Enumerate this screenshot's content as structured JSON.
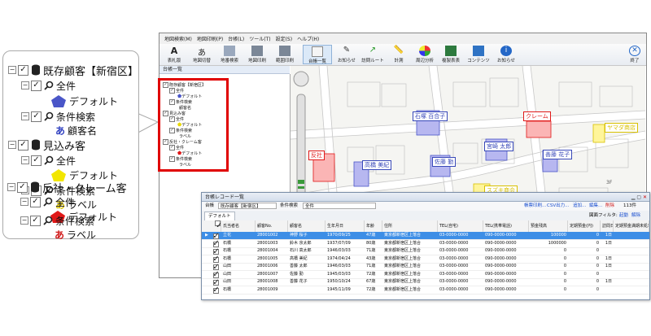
{
  "callout_tree": {
    "root": {
      "label": "既存顧客【新宿区】"
    },
    "items": [
      {
        "label": "全件"
      },
      {
        "label": "デフォルト"
      },
      {
        "label": "条件検索"
      },
      {
        "label": "顧客名"
      },
      {
        "label": "見込み客"
      },
      {
        "label": "全件"
      },
      {
        "label": "デフォルト"
      },
      {
        "label": "条件検索"
      },
      {
        "label": "ラベル"
      },
      {
        "label": "反社・クレーム客"
      },
      {
        "label": "全件"
      },
      {
        "label": "デフォルト"
      },
      {
        "label": "条件検索"
      },
      {
        "label": "ラベル"
      }
    ],
    "label_glyph": "あ",
    "colors": {
      "default_pentagon_1": "#4a56c8",
      "default_pentagon_2": "#f2e600",
      "default_pentagon_3": "#e01818",
      "label_icon_1": "#3040c0",
      "label_icon_2": "#d8c000",
      "label_icon_3": "#d01818"
    }
  },
  "app": {
    "menu": [
      "地図検索(M)",
      "地図印刷(P)",
      "台帳(L)",
      "ツール(T)",
      "設定(S)",
      "ヘルプ(H)"
    ],
    "toolbar": [
      "表札版",
      "地図切替",
      "地番検索",
      "地図印刷",
      "範囲印刷",
      "台帳一覧",
      "お知らせ",
      "訪問ルート",
      "計測",
      "周辺分析",
      "複製表表",
      "コンテンツ",
      "お知らせ"
    ],
    "close_label": "終了",
    "panel_title": "台帳一覧",
    "mini_tree": [
      "既存顧客【新宿区】",
      "全件",
      "デフォルト",
      "条件検索",
      "顧客名",
      "見込み客",
      "全件",
      "デフォルト",
      "条件検索",
      "ラベル",
      "反社・クレーム客",
      "全件",
      "デフォルト",
      "条件検索",
      "ラベル"
    ]
  },
  "map": {
    "labels": [
      {
        "text": "石塚 百合子",
        "color": "#3848b8"
      },
      {
        "text": "クレーム",
        "color": "#e01818"
      },
      {
        "text": "宮崎 太郎",
        "color": "#3848b8"
      },
      {
        "text": "反社",
        "color": "#e01818"
      },
      {
        "text": "高橋 美紀",
        "color": "#3848b8"
      },
      {
        "text": "佐藤 勤",
        "color": "#3848b8"
      },
      {
        "text": "善藤 花子",
        "color": "#3848b8"
      },
      {
        "text": "ヤマダ商店",
        "color": "#d8c000"
      },
      {
        "text": "スズキ商会",
        "color": "#d8c000"
      }
    ],
    "addr_labels": [
      "3F",
      "3F"
    ]
  },
  "record_list": {
    "title": "台帳レコード一覧",
    "ledger_label": "台帳",
    "ledger_value": "既存顧客【新宿区】",
    "cond_label": "条件検索",
    "cond_value": "全件",
    "actions": [
      "帳票印刷...",
      "CSV出力...",
      "追加...",
      "編集...",
      "削除"
    ],
    "count": "113件",
    "filter_label": "図面フィルタ:",
    "filter_values": [
      "起動",
      "解除"
    ],
    "tab": "デフォルト",
    "columns": [
      "氏当者名",
      "顧客No.",
      "顧客名",
      "生年月日",
      "年齢",
      "住所",
      "TEL(自宅)",
      "TEL(携帯電話)",
      "預金残高",
      "定期預金(円)",
      "訪問日",
      "定期預金満期未処理"
    ],
    "rows": [
      {
        "staff": "立花",
        "no": "28001002",
        "name": "神野 桜子",
        "birth": "1970/09/25",
        "age": "47歳",
        "addr": "東京都新宿区上落合",
        "tel": "03-0000-0000",
        "mobile": "090-0000-0000",
        "deposit": "100000",
        "fixed": "0",
        "visit": "1日",
        "selected": true
      },
      {
        "staff": "石橋",
        "no": "28001003",
        "name": "鈴木 京太郎",
        "birth": "1937/07/09",
        "age": "80歳",
        "addr": "東京都新宿区上落合",
        "tel": "03-0000-0000",
        "mobile": "090-0000-0000",
        "deposit": "1000000",
        "fixed": "0",
        "visit": "1日",
        "selected": false
      },
      {
        "staff": "石橋",
        "no": "28001004",
        "name": "石川 高太郎",
        "birth": "1946/03/03",
        "age": "71歳",
        "addr": "東京都新宿区上落合",
        "tel": "03-0000-0000",
        "mobile": "090-0000-0000",
        "deposit": "0",
        "fixed": "0",
        "visit": "",
        "selected": false
      },
      {
        "staff": "石橋",
        "no": "28001005",
        "name": "高橋 美紀",
        "birth": "1974/04/24",
        "age": "43歳",
        "addr": "東京都新宿区上落合",
        "tel": "03-0000-0000",
        "mobile": "090-0000-0000",
        "deposit": "0",
        "fixed": "0",
        "visit": "1日",
        "selected": false
      },
      {
        "staff": "山田",
        "no": "28001006",
        "name": "善藤 太郎",
        "birth": "1946/03/03",
        "age": "71歳",
        "addr": "東京都新宿区上落合",
        "tel": "03-0000-0000",
        "mobile": "090-0000-0000",
        "deposit": "0",
        "fixed": "0",
        "visit": "1日",
        "selected": false
      },
      {
        "staff": "山田",
        "no": "28001007",
        "name": "佐藤 勤",
        "birth": "1945/03/03",
        "age": "72歳",
        "addr": "東京都新宿区上落合",
        "tel": "03-0000-0000",
        "mobile": "090-0000-0000",
        "deposit": "0",
        "fixed": "0",
        "visit": "",
        "selected": false
      },
      {
        "staff": "山田",
        "no": "28001008",
        "name": "善藤 花子",
        "birth": "1950/10/24",
        "age": "67歳",
        "addr": "東京都新宿区上落合",
        "tel": "03-0000-0000",
        "mobile": "090-0000-0000",
        "deposit": "0",
        "fixed": "0",
        "visit": "1日",
        "selected": false
      },
      {
        "staff": "石橋",
        "no": "28001009",
        "name": "",
        "birth": "1945/11/09",
        "age": "72歳",
        "addr": "東京都新宿区上落合",
        "tel": "03-0000-0000",
        "mobile": "090-0000-0000",
        "deposit": "0",
        "fixed": "0",
        "visit": "",
        "selected": false
      }
    ]
  }
}
